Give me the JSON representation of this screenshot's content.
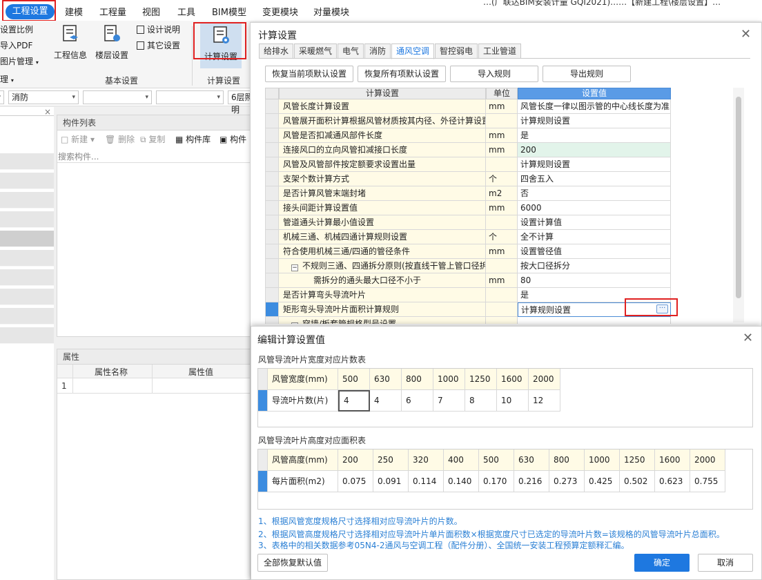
{
  "menubar": {
    "items": [
      "工程设置",
      "建模",
      "工程量",
      "视图",
      "工具",
      "BIM模型",
      "变更模块",
      "对量模块"
    ],
    "partial_title": "…(广联达BIM安装计量 GQI2021)……【新建工程\\楼层设置】…"
  },
  "ribbon": {
    "left_small": [
      "设置比例",
      "导入PDF",
      "图片管理",
      "理"
    ],
    "project_info": "工程信息",
    "floor_settings": "楼层设置",
    "design_notes": "设计说明",
    "other_settings": "其它设置",
    "calc_settings": "计算设置",
    "group_basic": "基本设置",
    "group_calc": "计算设置"
  },
  "filter": {
    "dd2": "消防",
    "dd5": "6层照明"
  },
  "component_list": {
    "title": "构件列表",
    "new": "新建",
    "delete": "删除",
    "copy": "复制",
    "library": "构件库",
    "component": "构件",
    "search_placeholder": "搜索构件..."
  },
  "properties": {
    "title": "属性",
    "col_name": "属性名称",
    "col_value": "属性值",
    "row1": "1"
  },
  "calc_dialog": {
    "title": "计算设置",
    "tabs": [
      "给排水",
      "采暖燃气",
      "电气",
      "消防",
      "通风空调",
      "智控弱电",
      "工业管道"
    ],
    "active_tab": "通风空调",
    "buttons": [
      "恢复当前项默认设置",
      "恢复所有项默认设置",
      "导入规则",
      "导出规则"
    ],
    "grid_headers": {
      "name": "计算设置",
      "unit": "单位",
      "value": "设置值"
    },
    "rows": [
      {
        "name": "风管长度计算设置",
        "unit": "mm",
        "value": "风管长度一律以图示管的中心线长度为准"
      },
      {
        "name": "风管展开面积计算根据风管材质按其内径、外径计算设置",
        "unit": "",
        "value": "计算规则设置"
      },
      {
        "name": "风管是否扣减通风部件长度",
        "unit": "mm",
        "value": "是"
      },
      {
        "name": "连接风口的立向风管扣减接口长度",
        "unit": "mm",
        "value": "200"
      },
      {
        "name": "风管及风管部件按定额要求设置出量",
        "unit": "",
        "value": "计算规则设置"
      },
      {
        "name": "支架个数计算方式",
        "unit": "个",
        "value": "四舍五入"
      },
      {
        "name": "是否计算风管末端封堵",
        "unit": "m2",
        "value": "否"
      },
      {
        "name": "接头间距计算设置值",
        "unit": "mm",
        "value": "6000"
      },
      {
        "name": "管道通头计算最小值设置",
        "unit": "",
        "value": "设置计算值"
      },
      {
        "name": "机械三通、机械四通计算规则设置",
        "unit": "个",
        "value": "全不计算"
      },
      {
        "name": "符合使用机械三通/四通的管径条件",
        "unit": "mm",
        "value": "设置管径值"
      },
      {
        "name": "不规则三通、四通拆分原则(按直线干管上管口径拆分)",
        "unit": "",
        "value": "按大口径拆分"
      },
      {
        "name": "需拆分的通头最大口径不小于",
        "unit": "mm",
        "value": "80"
      },
      {
        "name": "是否计算弯头导流叶片",
        "unit": "",
        "value": "是"
      },
      {
        "name": "矩形弯头导流叶片面积计算规则",
        "unit": "",
        "value": "计算规则设置"
      },
      {
        "name": "穿墙/板套管规格型号设置",
        "unit": "",
        "value": ""
      }
    ],
    "collapse_glyph": "−"
  },
  "edit_dialog": {
    "title": "编辑计算设置值",
    "section1": "风管导流叶片宽度对应片数表",
    "width_label": "风管宽度(mm)",
    "widths": [
      "500",
      "630",
      "800",
      "1000",
      "1250",
      "1600",
      "2000"
    ],
    "count_label": "导流叶片数(片)",
    "counts": [
      "4",
      "4",
      "6",
      "7",
      "8",
      "10",
      "12"
    ],
    "section2": "风管导流叶片高度对应面积表",
    "height_label": "风管高度(mm)",
    "heights": [
      "200",
      "250",
      "320",
      "400",
      "500",
      "630",
      "800",
      "1000",
      "1250",
      "1600",
      "2000"
    ],
    "area_label": "每片面积(m2)",
    "areas": [
      "0.075",
      "0.091",
      "0.114",
      "0.140",
      "0.170",
      "0.216",
      "0.273",
      "0.425",
      "0.502",
      "0.623",
      "0.755"
    ],
    "notes": [
      "1、根据风管宽度规格尺寸选择相对应导流叶片的片数。",
      "2、根据风管高度规格尺寸选择相对应导流叶片单片面积数×根据宽度尺寸已选定的导流叶片数=该规格的风管导流叶片总面积。",
      "3、表格中的相关数据参考05N4-2通风与空调工程（配件分册）、全国统一安装工程预算定额释汇编。"
    ],
    "restore_all": "全部恢复默认值",
    "ok": "确定",
    "cancel": "取消"
  },
  "colors": {
    "accent": "#1e78e0",
    "highlight_box": "#e02020",
    "note_text": "#2a7fd4"
  }
}
